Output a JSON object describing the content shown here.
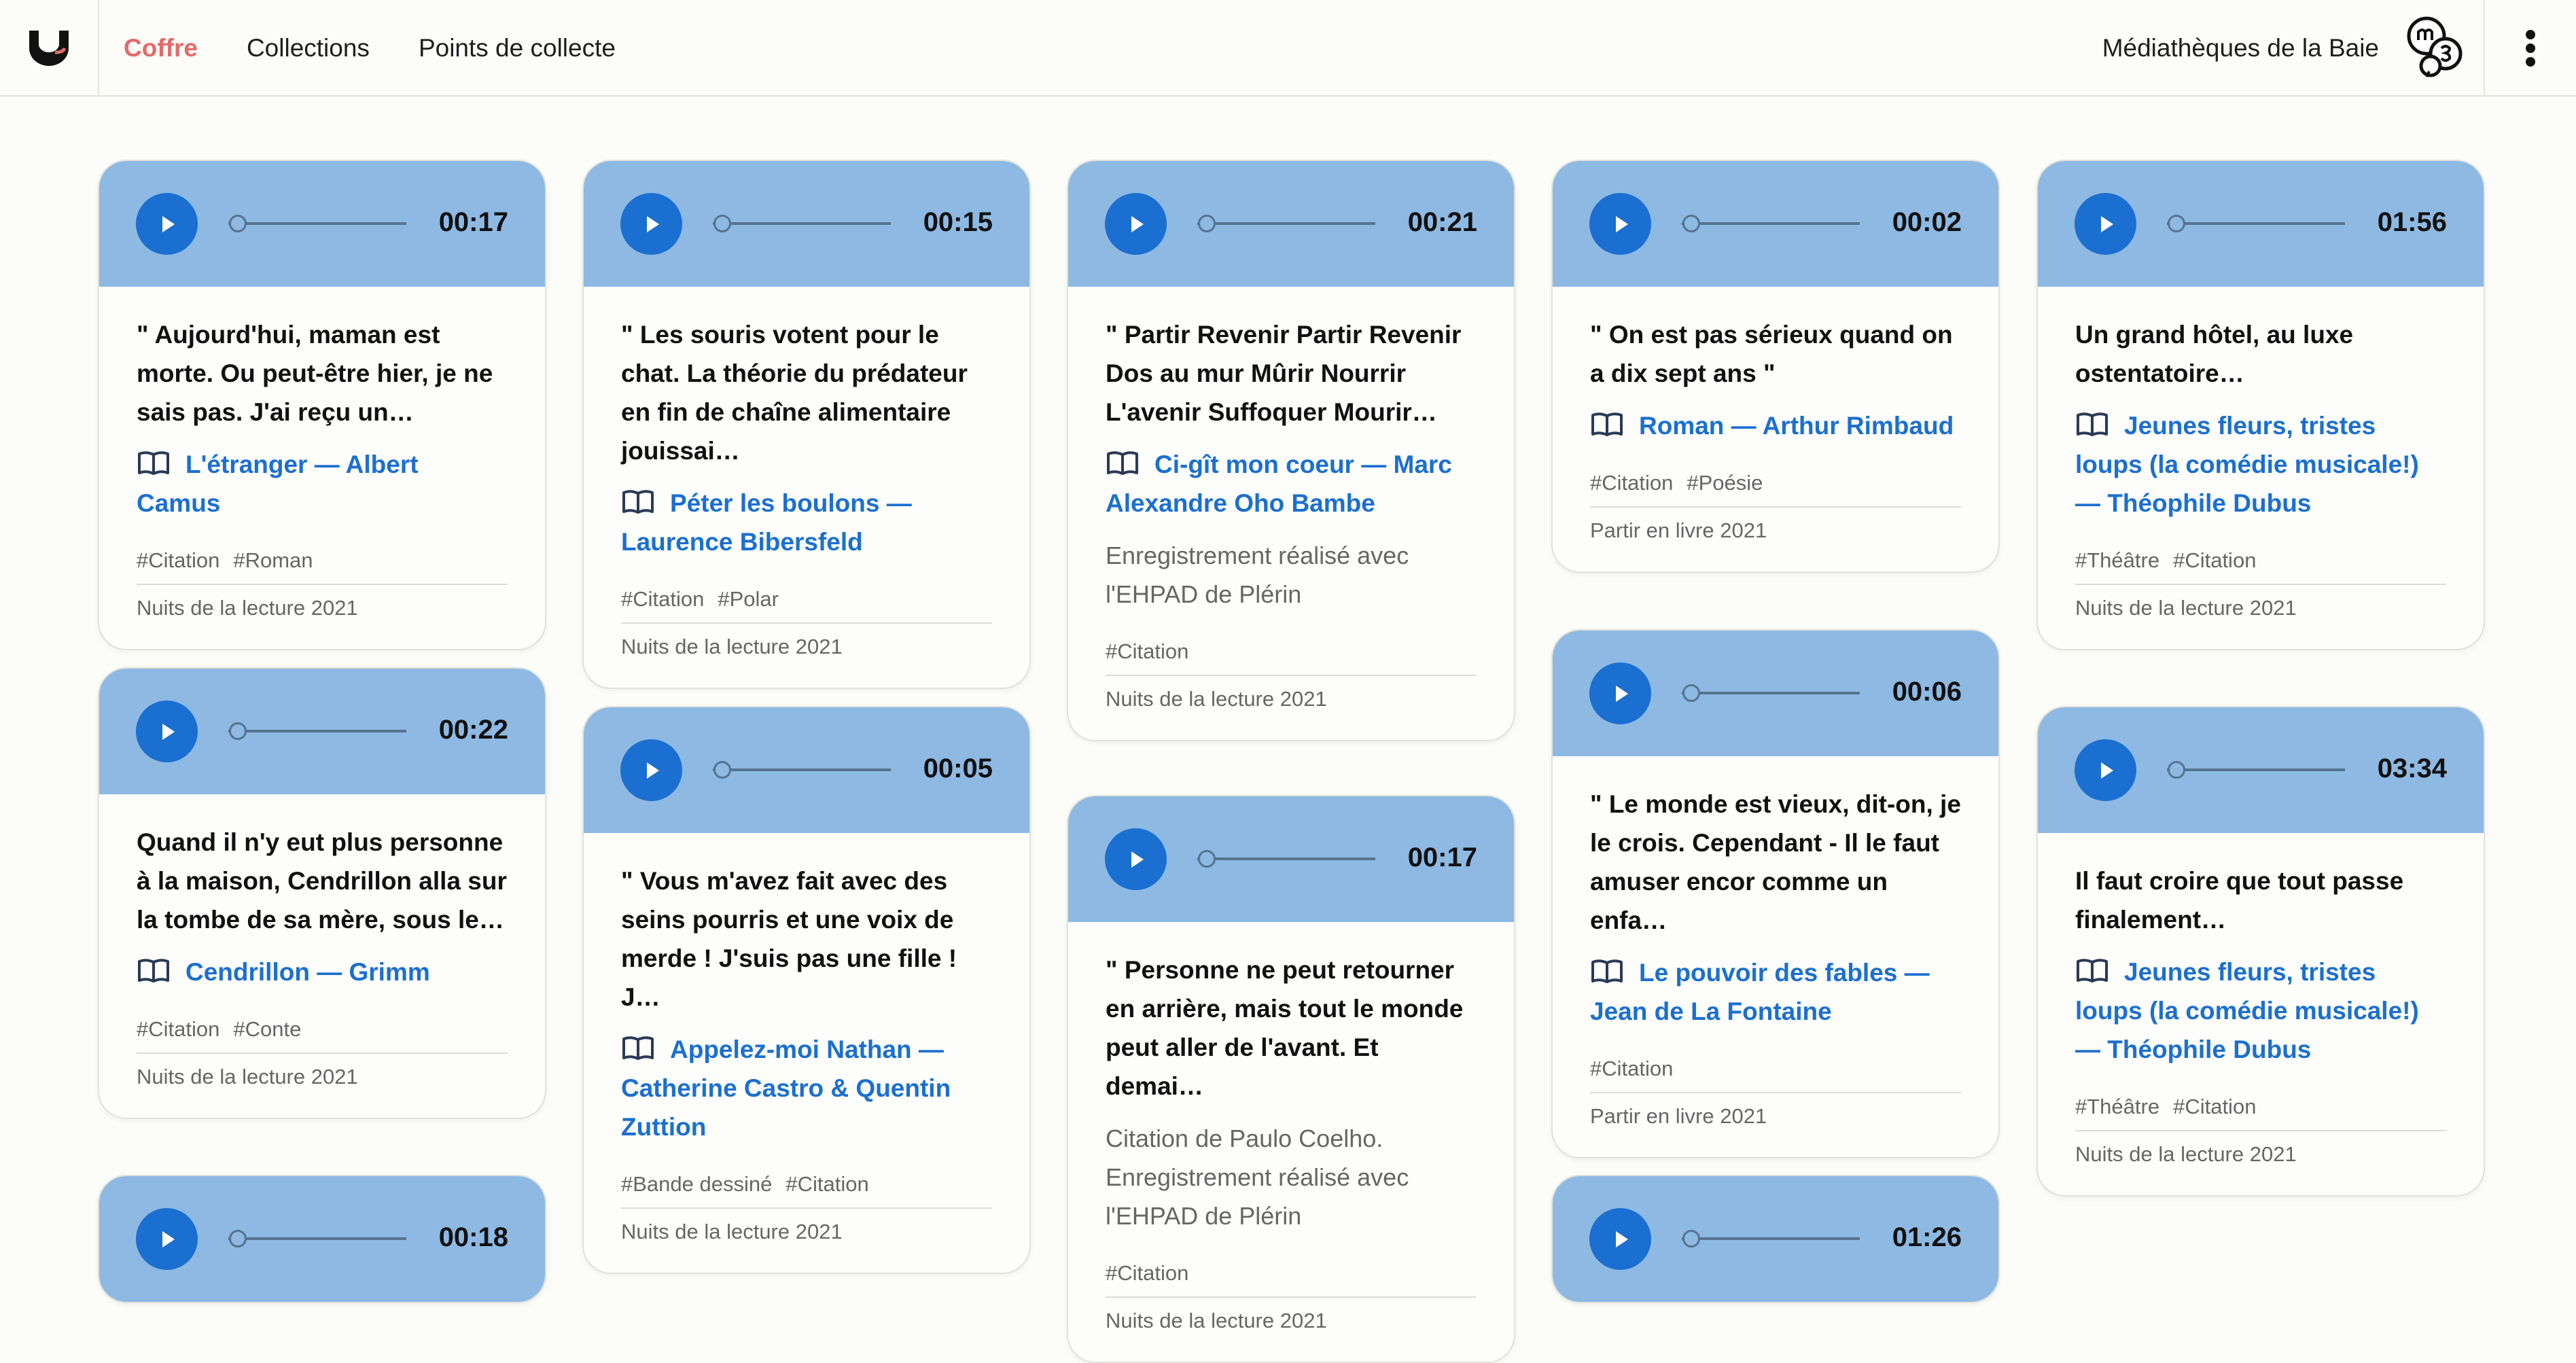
{
  "nav": {
    "items": [
      {
        "label": "Coffre",
        "active": true
      },
      {
        "label": "Collections",
        "active": false
      },
      {
        "label": "Points de collecte",
        "active": false
      }
    ],
    "org_name": "Médiathèques de la Baie"
  },
  "colors": {
    "accent": "#e56a6a",
    "link": "#1b6fd0",
    "player_bg": "#8db9e3"
  },
  "cards": [
    {
      "duration": "00:17",
      "quote": "\" Aujourd'hui, maman est morte. Ou peut-être hier, je ne sais pas. J'ai reçu un…",
      "book": "L'étranger — Albert Camus",
      "desc": "",
      "tags": [
        "#Citation",
        "#Roman"
      ],
      "event": "Nuits de la lecture 2021"
    },
    {
      "duration": "00:22",
      "quote": "Quand il n'y eut plus personne à la maison, Cendrillon alla sur la tombe de sa mère, sous le…",
      "book": "Cendrillon — Grimm",
      "desc": "",
      "tags": [
        "#Citation",
        "#Conte"
      ],
      "event": "Nuits de la lecture 2021"
    },
    {
      "duration": "00:18",
      "quote": "",
      "book": "",
      "desc": "",
      "tags": [],
      "event": ""
    },
    {
      "duration": "00:15",
      "quote": "\" Les souris votent pour le chat. La théorie du prédateur en fin de chaîne alimentaire jouissai…",
      "book": "Péter les boulons — Laurence Bibersfeld",
      "desc": "",
      "tags": [
        "#Citation",
        "#Polar"
      ],
      "event": "Nuits de la lecture 2021"
    },
    {
      "duration": "00:05",
      "quote": "\" Vous m'avez fait avec des seins pourris et une voix de merde ! J'suis pas une fille ! J…",
      "book": "Appelez-moi Nathan — Catherine Castro & Quentin Zuttion",
      "desc": "",
      "tags": [
        "#Bande dessiné",
        "#Citation"
      ],
      "event": "Nuits de la lecture 2021"
    },
    {
      "duration": "00:21",
      "quote": "\" Partir Revenir Partir Revenir Dos au mur Mûrir Nourrir L'avenir Suffoquer Mourir…",
      "book": "Ci-gît mon coeur — Marc Alexandre Oho Bambe",
      "desc": "Enregistrement réalisé avec l'EHPAD de Plérin",
      "tags": [
        "#Citation"
      ],
      "event": "Nuits de la lecture 2021"
    },
    {
      "duration": "00:17",
      "quote": "\" Personne ne peut retourner en arrière, mais tout le monde peut aller de l'avant. Et demai…",
      "book": "",
      "desc": "Citation de Paulo Coelho. Enregistrement réalisé avec l'EHPAD de Plérin",
      "tags": [
        "#Citation"
      ],
      "event": "Nuits de la lecture 2021"
    },
    {
      "duration": "00:02",
      "quote": "\" On est pas sérieux quand on a dix sept ans \"",
      "book": "Roman — Arthur Rimbaud",
      "desc": "",
      "tags": [
        "#Citation",
        "#Poésie"
      ],
      "event": "Partir en livre 2021"
    },
    {
      "duration": "00:06",
      "quote": "\" Le monde est vieux, dit-on, je le crois. Cependant - Il le faut amuser encor comme un enfa…",
      "book": "Le pouvoir des fables — Jean de La Fontaine",
      "desc": "",
      "tags": [
        "#Citation"
      ],
      "event": "Partir en livre 2021"
    },
    {
      "duration": "01:26",
      "quote": "",
      "book": "",
      "desc": "",
      "tags": [],
      "event": ""
    },
    {
      "duration": "01:56",
      "quote": "Un grand hôtel, au luxe ostentatoire…",
      "book": "Jeunes fleurs, tristes loups (la comédie musicale!) — Théophile Dubus",
      "desc": "",
      "tags": [
        "#Théâtre",
        "#Citation"
      ],
      "event": "Nuits de la lecture 2021"
    },
    {
      "duration": "03:34",
      "quote": "Il faut croire que tout passe finalement…",
      "book": "Jeunes fleurs, tristes loups (la comédie musicale!) — Théophile Dubus",
      "desc": "",
      "tags": [
        "#Théâtre",
        "#Citation"
      ],
      "event": "Nuits de la lecture 2021"
    }
  ]
}
